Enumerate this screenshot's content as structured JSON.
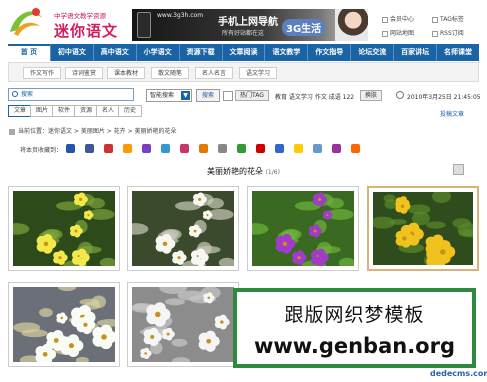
{
  "logo": {
    "tagline": "中学语文教学资源",
    "name": "迷你语文"
  },
  "banner": {
    "url": "www.3g3h.com",
    "line1": "手机上网导航",
    "line2": "所有好站都在这",
    "badge": "3G生活"
  },
  "toplinks": [
    "会员中心",
    "TAG标签",
    "网站地图",
    "RSS订阅"
  ],
  "nav": {
    "active": "首 页",
    "items": [
      "初中语文",
      "高中语文",
      "小学语文",
      "资源下载",
      "文章阅读",
      "语文教学",
      "作文指导",
      "论坛交流",
      "百家讲坛",
      "名师课堂"
    ]
  },
  "subnav": [
    "作文写作",
    "诗词鉴赏",
    "课本教材",
    "散文随笔",
    "名人名言",
    "语文学习"
  ],
  "search": {
    "placeholder": "搜索",
    "tabs": [
      "文章",
      "图片",
      "软件",
      "资源",
      "名人",
      "历史"
    ],
    "select_value": "智能搜索",
    "button": "搜索",
    "hot_tag": "热门TAG",
    "hot_words": "教育  语文学习  作文  成语  122",
    "switch_label": "换肤",
    "datetime": "2010年3月25日 21:45:05",
    "submit_link": "投稿文章"
  },
  "breadcrumb": "当前位置：迷你语文 > 美丽图片 > 花卉 > 美丽娇艳的花朵",
  "share_label": "将本页收藏到：",
  "share_colors": [
    "#2255aa",
    "#3b5998",
    "#cc3333",
    "#ff9900",
    "#7b3fbf",
    "#3399cc",
    "#cc3366",
    "#e07b00",
    "#888888",
    "#339933",
    "#cc0000",
    "#3366cc",
    "#ffcc00",
    "#6699cc",
    "#993399",
    "#ff6600"
  ],
  "gallery": {
    "title": "美丽娇艳的花朵",
    "count": "(1/6)",
    "photos": [
      {
        "subject": "yellow-orchids",
        "bg": "#2c4a1a",
        "flower": "#f2e84a",
        "accent": "#7aa43a"
      },
      {
        "subject": "white-blossoms",
        "bg": "#3b4a2c",
        "flower": "#f7f7f2",
        "accent": "#c9c9b8"
      },
      {
        "subject": "purple-orchids",
        "bg": "#3a6a22",
        "flower": "#a13cc8",
        "accent": "#6cb33a"
      },
      {
        "subject": "yellow-small-flowers",
        "bg": "#2f4c1c",
        "flower": "#f0c21d",
        "accent": "#5a8a2a"
      },
      {
        "subject": "white-phalaenopsis",
        "bg": "#6b6f78",
        "flower": "#fbfbf6",
        "accent": "#d6d0a0"
      },
      {
        "subject": "white-lilies",
        "bg": "#8c8c8c",
        "flower": "#f5f5f5",
        "accent": "#c8c8c8"
      }
    ]
  },
  "watermark": {
    "cn": "跟版网织梦模板",
    "url": "www.genban.org"
  },
  "footmark": "dedecms.com",
  "colors": {
    "nav_blue": "#1a64a6",
    "watermark_green": "#2e8b3d",
    "logo_pink": "#d81b60"
  }
}
